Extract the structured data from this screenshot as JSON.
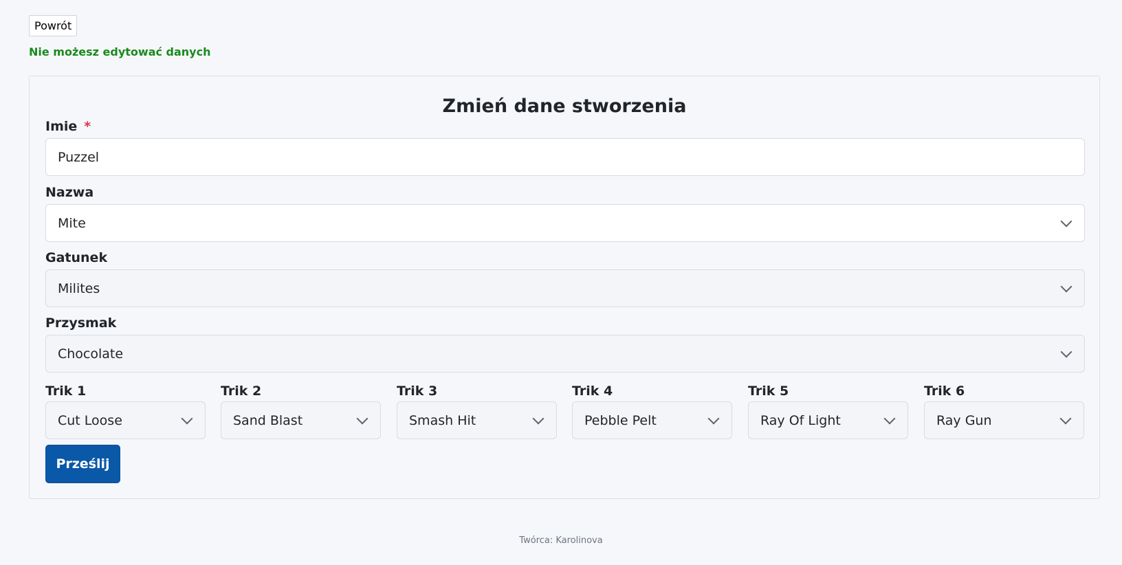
{
  "nav": {
    "back_label": "Powrót"
  },
  "notice": {
    "text": "Nie możesz edytować danych",
    "color": "#198a1c"
  },
  "form": {
    "title": "Zmień dane stworzenia",
    "name": {
      "label": "Imie",
      "required_mark": "*",
      "value": "Puzzel"
    },
    "species_name": {
      "label": "Nazwa",
      "value": "Mite"
    },
    "genus": {
      "label": "Gatunek",
      "value": "Milites"
    },
    "treat": {
      "label": "Przysmak",
      "value": "Chocolate"
    },
    "tricks": [
      {
        "label": "Trik 1",
        "value": "Cut Loose"
      },
      {
        "label": "Trik 2",
        "value": "Sand Blast"
      },
      {
        "label": "Trik 3",
        "value": "Smash Hit"
      },
      {
        "label": "Trik 4",
        "value": "Pebble Pelt"
      },
      {
        "label": "Trik 5",
        "value": "Ray Of Light"
      },
      {
        "label": "Trik 6",
        "value": "Ray Gun"
      }
    ],
    "submit_label": "Prześlij",
    "accent_color": "#0a58a8"
  },
  "footer": {
    "text": "Twórca: Karolinova"
  }
}
